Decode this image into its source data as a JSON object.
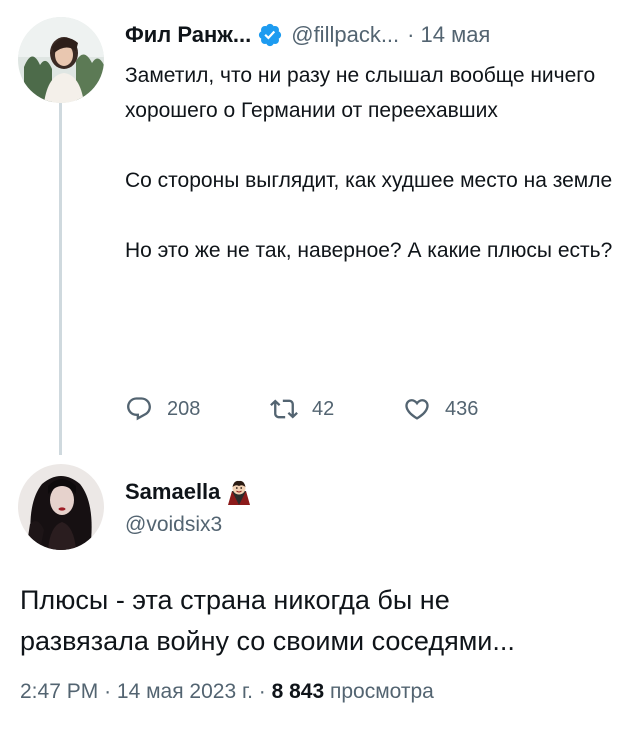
{
  "tweet": {
    "author_name": "Фил Ранж...",
    "verified_icon": "verified-badge-icon",
    "handle": "@fillpack...",
    "separator": "·",
    "date": "14 мая",
    "text": {
      "p1": "Заметил, что ни разу не слышал вообще ничего хорошего о Германии от переехавших",
      "p2": "Со стороны выглядит, как худшее место на земле",
      "p3": "Но это же не так, наверное? А какие плюсы есть?"
    },
    "actions": {
      "replies": "208",
      "retweets": "42",
      "likes": "436"
    }
  },
  "reply": {
    "author_name": "Samaella",
    "name_emoji": "vampire-emoji",
    "handle": "@voidsix3",
    "text_line1": "Плюсы - эта страна никогда бы не",
    "text_line2": "развязала войну со своими соседями...",
    "time": "2:47 PM",
    "sep1": "·",
    "date": "14 мая 2023 г.",
    "sep2": "·",
    "views_count": "8 843",
    "views_label": "просмотра"
  },
  "colors": {
    "text": "#0f1419",
    "secondary": "#536471",
    "verified": "#1d9bf0",
    "thread_line": "#cfd9de"
  }
}
